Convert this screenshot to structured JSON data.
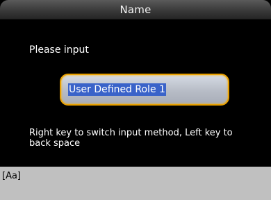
{
  "window": {
    "title": "Name"
  },
  "form": {
    "prompt": "Please input",
    "input_value": "User Defined Role 1",
    "hint": "Right key to switch input method, Left key to back space"
  },
  "ime": {
    "mode_label": "[Aa]"
  },
  "colors": {
    "background": "#000000",
    "accent_border": "#e8a000",
    "selection": "#3a63c9",
    "ime_bar": "#c0c0c0"
  }
}
